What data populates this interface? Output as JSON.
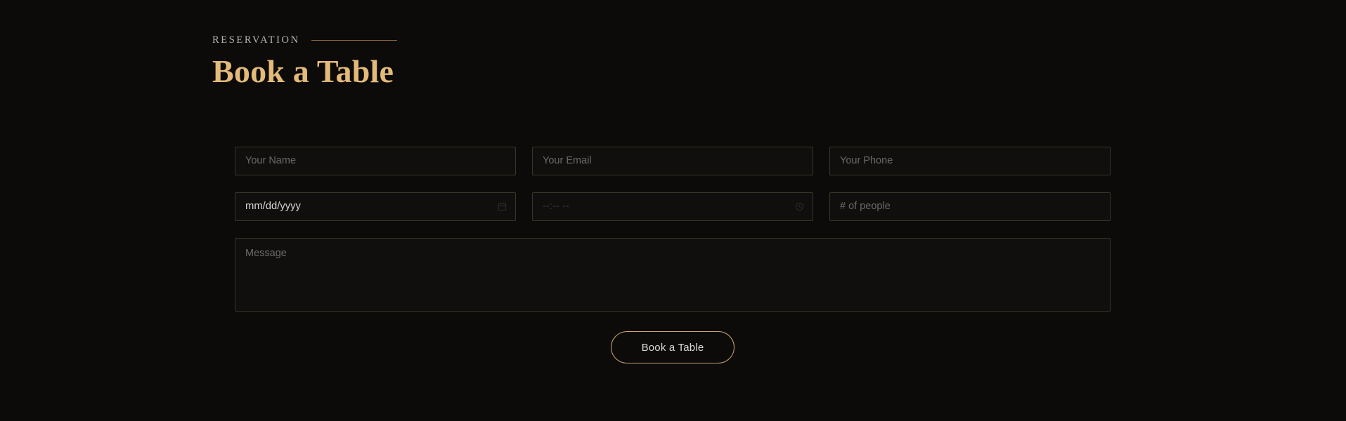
{
  "theme": {
    "background": "#0c0b0a",
    "accent_gold": "#e3ba79",
    "border_gold": "#cba571",
    "field_border": "#3a3527",
    "placeholder": "#6d6a66"
  },
  "header": {
    "eyebrow": "RESERVATION",
    "title": "Book a Table"
  },
  "form": {
    "fields": {
      "name": {
        "placeholder": "Your Name",
        "value": ""
      },
      "email": {
        "placeholder": "Your Email",
        "value": ""
      },
      "phone": {
        "placeholder": "Your Phone",
        "value": ""
      },
      "date": {
        "placeholder": "mm/dd/yyyy",
        "value": "mm/dd/yyyy",
        "icon": "calendar-icon"
      },
      "time": {
        "placeholder": "--:-- --",
        "value": "--:-- --",
        "icon": "clock-icon"
      },
      "people": {
        "placeholder": "# of people",
        "value": ""
      },
      "message": {
        "placeholder": "Message",
        "value": ""
      }
    },
    "submit_label": "Book a Table"
  }
}
